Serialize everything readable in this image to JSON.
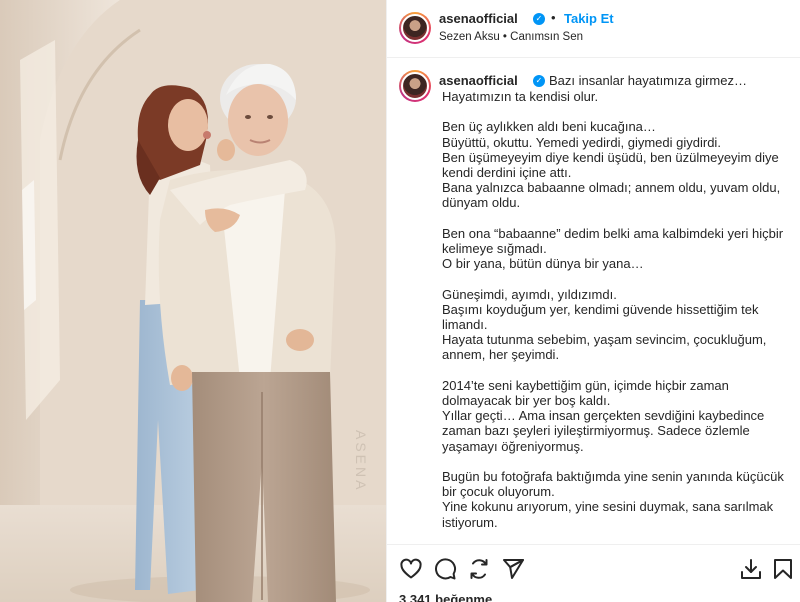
{
  "post": {
    "username": "asenaofficial",
    "verified_glyph": "✓",
    "separator": "•",
    "follow_label": "Takip Et",
    "music": "Sezen Aksu • Canımsın Sen",
    "photo_watermark": "ASENA"
  },
  "caption": {
    "first_line": "Bazı insanlar hayatımıza girmez…",
    "body": "Hayatımızın ta kendisi olur.\n\nBen üç aylıkken aldı beni kucağına…\nBüyüttü, okuttu. Yemedi yedirdi, giymedi giydirdi.\nBen üşümeyeyim diye kendi üşüdü, ben üzülmeyeyim diye kendi derdini içine attı.\nBana yalnızca babaanne olmadı; annem oldu, yuvam oldu, dünyam oldu.\n\nBen ona “babaanne” dedim belki ama kalbimdeki yeri hiçbir kelimeye sığmadı.\nO bir yana, bütün dünya bir yana…\n\nGüneşimdi, ayımdı, yıldızımdı.\nBaşımı koyduğum yer, kendimi güvende hissettiğim tek limandı.\nHayata tutunma sebebim, yaşam sevincim, çocukluğum, annem, her şeyimdi.\n\n2014’te seni kaybettiğim gün, içimde hiçbir zaman dolmayacak bir yer boş kaldı.\nYıllar geçti… Ama insan gerçekten sevdiğini kaybedince zaman bazı şeyleri iyileştirmiyormuş. Sadece özlemle yaşamayı öğreniyormuş.\n\nBugün bu fotoğrafa baktığımda yine senin yanında küçücük bir çocuk oluyorum.\nYine kokunu arıyorum, yine sesini duymak, sana sarılmak istiyorum."
  },
  "actions": {
    "icons": [
      "heart-icon",
      "comment-icon",
      "share-icon",
      "send-icon",
      "download-icon",
      "bookmark-icon"
    ],
    "likes": "3.341 beğenme"
  },
  "colors": {
    "accent": "#0095f6",
    "text": "#262626",
    "divider": "#efefef"
  }
}
